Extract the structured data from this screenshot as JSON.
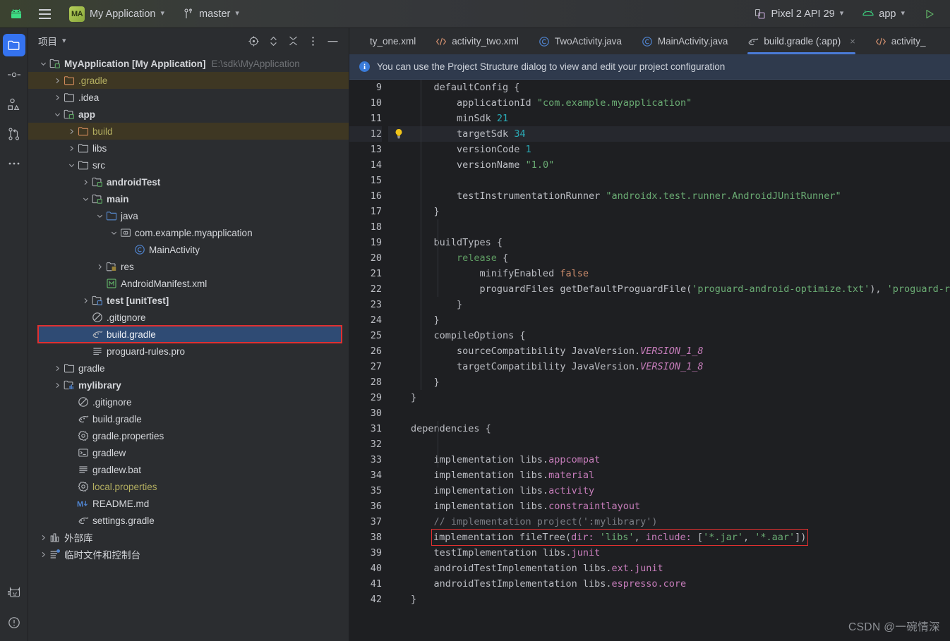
{
  "topbar": {
    "android_icon": "android-robot-icon",
    "menu_icon": "hamburger-menu-icon",
    "project_badge": "MA",
    "project_name": "My Application",
    "branch_icon": "vcs-branch-icon",
    "branch_name": "master",
    "device_icon": "device-icon",
    "device_name": "Pixel 2 API 29",
    "run_config_icon": "android-app-icon",
    "run_config_name": "app",
    "run_icon": "run-play-icon"
  },
  "rail": {
    "items": [
      {
        "name": "project-tool-window",
        "icon": "folder-icon",
        "active": true
      },
      {
        "name": "commit-tool-window",
        "icon": "commit-node-icon",
        "active": false
      },
      {
        "name": "structure-tool-window",
        "icon": "shapes-icon",
        "active": false
      },
      {
        "name": "pull-requests-tool-window",
        "icon": "branch-merge-icon",
        "active": false
      },
      {
        "name": "more-tool-windows",
        "icon": "ellipsis-icon",
        "active": false
      }
    ],
    "bottom_items": [
      {
        "name": "device-manager",
        "icon": "cat-device-icon"
      },
      {
        "name": "problems",
        "icon": "warning-circle-icon"
      }
    ]
  },
  "project_panel": {
    "title": "项目",
    "title_chevron": "chevron-down-icon",
    "actions": [
      {
        "name": "select-opened-file-button",
        "icon": "target-icon"
      },
      {
        "name": "expand-collapse-button",
        "icon": "updown-chevron-icon"
      },
      {
        "name": "collapse-all-button",
        "icon": "collapse-all-icon"
      },
      {
        "name": "options-button",
        "icon": "vertical-dots-icon"
      },
      {
        "name": "hide-button",
        "icon": "minimize-icon"
      }
    ],
    "tree": [
      {
        "depth": 0,
        "arrow": "down",
        "icon": "module-folder-icon",
        "label": "MyApplication [My Application]",
        "bold": true,
        "suffix": "E:\\sdk\\MyApplication"
      },
      {
        "depth": 1,
        "arrow": "right",
        "icon": "excluded-folder-icon",
        "label": ".gradle",
        "yellow": true,
        "highlight": true
      },
      {
        "depth": 1,
        "arrow": "right",
        "icon": "folder-icon",
        "label": ".idea"
      },
      {
        "depth": 1,
        "arrow": "down",
        "icon": "module-folder-icon",
        "label": "app",
        "bold": true
      },
      {
        "depth": 2,
        "arrow": "right",
        "icon": "excluded-folder-icon",
        "label": "build",
        "yellow": true,
        "highlight": true
      },
      {
        "depth": 2,
        "arrow": "right",
        "icon": "folder-icon",
        "label": "libs"
      },
      {
        "depth": 2,
        "arrow": "down",
        "icon": "folder-icon",
        "label": "src"
      },
      {
        "depth": 3,
        "arrow": "right",
        "icon": "module-folder-icon",
        "label": "androidTest",
        "bold": true
      },
      {
        "depth": 3,
        "arrow": "down",
        "icon": "module-folder-icon",
        "label": "main",
        "bold": true
      },
      {
        "depth": 4,
        "arrow": "down",
        "icon": "source-folder-icon",
        "label": "java"
      },
      {
        "depth": 5,
        "arrow": "down",
        "icon": "package-icon",
        "label": "com.example.myapplication"
      },
      {
        "depth": 6,
        "arrow": "none",
        "icon": "java-class-icon",
        "label": "MainActivity"
      },
      {
        "depth": 4,
        "arrow": "right",
        "icon": "res-folder-icon",
        "label": "res"
      },
      {
        "depth": 4,
        "arrow": "none",
        "icon": "manifest-icon",
        "label": "AndroidManifest.xml"
      },
      {
        "depth": 3,
        "arrow": "right",
        "icon": "test-folder-icon",
        "label": "test [unitTest]",
        "bold": true
      },
      {
        "depth": 3,
        "arrow": "none",
        "icon": "gitignore-icon",
        "label": ".gitignore"
      },
      {
        "depth": 3,
        "arrow": "none",
        "icon": "gradle-icon",
        "label": "build.gradle",
        "selected": true
      },
      {
        "depth": 3,
        "arrow": "none",
        "icon": "text-file-icon",
        "label": "proguard-rules.pro"
      },
      {
        "depth": 1,
        "arrow": "right",
        "icon": "folder-icon",
        "label": "gradle"
      },
      {
        "depth": 1,
        "arrow": "right",
        "icon": "library-module-icon",
        "label": "mylibrary",
        "bold": true
      },
      {
        "depth": 2,
        "arrow": "none",
        "icon": "gitignore-icon",
        "label": ".gitignore"
      },
      {
        "depth": 2,
        "arrow": "none",
        "icon": "gradle-icon",
        "label": "build.gradle"
      },
      {
        "depth": 2,
        "arrow": "none",
        "icon": "properties-icon",
        "label": "gradle.properties"
      },
      {
        "depth": 2,
        "arrow": "none",
        "icon": "shell-script-icon",
        "label": "gradlew"
      },
      {
        "depth": 2,
        "arrow": "none",
        "icon": "text-file-icon",
        "label": "gradlew.bat"
      },
      {
        "depth": 2,
        "arrow": "none",
        "icon": "properties-icon",
        "label": "local.properties",
        "yellow": true
      },
      {
        "depth": 2,
        "arrow": "none",
        "icon": "markdown-icon",
        "label": "README.md"
      },
      {
        "depth": 2,
        "arrow": "none",
        "icon": "gradle-icon",
        "label": "settings.gradle"
      },
      {
        "depth": 0,
        "arrow": "right",
        "icon": "external-libraries-icon",
        "label": "外部库"
      },
      {
        "depth": 0,
        "arrow": "right",
        "icon": "scratches-icon",
        "label": "临时文件和控制台"
      }
    ]
  },
  "editor": {
    "tabs": [
      {
        "label": "ty_one.xml",
        "icon": "xml-icon",
        "active": false,
        "closable": false,
        "clipped": true
      },
      {
        "label": "activity_two.xml",
        "icon": "xml-icon",
        "active": false,
        "closable": false
      },
      {
        "label": "TwoActivity.java",
        "icon": "java-class-icon",
        "active": false,
        "closable": false
      },
      {
        "label": "MainActivity.java",
        "icon": "java-class-icon",
        "active": false,
        "closable": false
      },
      {
        "label": "build.gradle (:app)",
        "icon": "gradle-icon",
        "active": true,
        "closable": true
      },
      {
        "label": "activity_",
        "icon": "xml-icon",
        "active": false,
        "closable": false,
        "clipped": true
      }
    ],
    "notification": {
      "icon": "info-icon",
      "text": "You can use the Project Structure dialog to view and edit your project configuration"
    },
    "gutter_hint_icon": "lightbulb-icon",
    "gutter_hint_line": 12,
    "current_line": 12,
    "lines": [
      {
        "n": 9,
        "tokens": [
          {
            "t": "    defaultConfig {",
            "c": "s-def"
          }
        ]
      },
      {
        "n": 10,
        "tokens": [
          {
            "t": "        applicationId ",
            "c": "s-def"
          },
          {
            "t": "\"com.example.myapplication\"",
            "c": "s-str"
          }
        ]
      },
      {
        "n": 11,
        "tokens": [
          {
            "t": "        minSdk ",
            "c": "s-def"
          },
          {
            "t": "21",
            "c": "s-num"
          }
        ]
      },
      {
        "n": 12,
        "tokens": [
          {
            "t": "        targetSdk ",
            "c": "s-def"
          },
          {
            "t": "34",
            "c": "s-num"
          }
        ]
      },
      {
        "n": 13,
        "tokens": [
          {
            "t": "        versionCode ",
            "c": "s-def"
          },
          {
            "t": "1",
            "c": "s-num"
          }
        ]
      },
      {
        "n": 14,
        "tokens": [
          {
            "t": "        versionName ",
            "c": "s-def"
          },
          {
            "t": "\"1.0\"",
            "c": "s-str"
          }
        ]
      },
      {
        "n": 15,
        "tokens": [
          {
            "t": "",
            "c": "s-def"
          }
        ]
      },
      {
        "n": 16,
        "tokens": [
          {
            "t": "        testInstrumentationRunner ",
            "c": "s-def"
          },
          {
            "t": "\"androidx.test.runner.AndroidJUnitRunner\"",
            "c": "s-str"
          }
        ]
      },
      {
        "n": 17,
        "tokens": [
          {
            "t": "    }",
            "c": "s-def"
          }
        ]
      },
      {
        "n": 18,
        "tokens": [
          {
            "t": "",
            "c": "s-def"
          }
        ]
      },
      {
        "n": 19,
        "tokens": [
          {
            "t": "    buildTypes {",
            "c": "s-def"
          }
        ]
      },
      {
        "n": 20,
        "tokens": [
          {
            "t": "        ",
            "c": "s-def"
          },
          {
            "t": "release",
            "c": "s-grn"
          },
          {
            "t": " {",
            "c": "s-def"
          }
        ]
      },
      {
        "n": 21,
        "tokens": [
          {
            "t": "            minifyEnabled ",
            "c": "s-def"
          },
          {
            "t": "false",
            "c": "s-kw"
          }
        ]
      },
      {
        "n": 22,
        "tokens": [
          {
            "t": "            proguardFiles getDefaultProguardFile(",
            "c": "s-def"
          },
          {
            "t": "'proguard-android-optimize.txt'",
            "c": "s-str"
          },
          {
            "t": "), ",
            "c": "s-def"
          },
          {
            "t": "'proguard-rules.pro'",
            "c": "s-str"
          }
        ]
      },
      {
        "n": 23,
        "tokens": [
          {
            "t": "        }",
            "c": "s-def"
          }
        ]
      },
      {
        "n": 24,
        "tokens": [
          {
            "t": "    }",
            "c": "s-def"
          }
        ]
      },
      {
        "n": 25,
        "tokens": [
          {
            "t": "    compileOptions {",
            "c": "s-def"
          }
        ]
      },
      {
        "n": 26,
        "tokens": [
          {
            "t": "        sourceCompatibility JavaVersion.",
            "c": "s-def"
          },
          {
            "t": "VERSION_1_8",
            "c": "s-italic"
          }
        ]
      },
      {
        "n": 27,
        "tokens": [
          {
            "t": "        targetCompatibility JavaVersion.",
            "c": "s-def"
          },
          {
            "t": "VERSION_1_8",
            "c": "s-italic"
          }
        ]
      },
      {
        "n": 28,
        "tokens": [
          {
            "t": "    }",
            "c": "s-def"
          }
        ]
      },
      {
        "n": 29,
        "tokens": [
          {
            "t": "}",
            "c": "s-def"
          }
        ]
      },
      {
        "n": 30,
        "tokens": [
          {
            "t": "",
            "c": "s-def"
          }
        ]
      },
      {
        "n": 31,
        "tokens": [
          {
            "t": "dependencies {",
            "c": "s-def"
          }
        ]
      },
      {
        "n": 32,
        "tokens": [
          {
            "t": "",
            "c": "s-def"
          }
        ]
      },
      {
        "n": 33,
        "tokens": [
          {
            "t": "    implementation libs.",
            "c": "s-def"
          },
          {
            "t": "appcompat",
            "c": "s-prop"
          }
        ]
      },
      {
        "n": 34,
        "tokens": [
          {
            "t": "    implementation libs.",
            "c": "s-def"
          },
          {
            "t": "material",
            "c": "s-prop"
          }
        ]
      },
      {
        "n": 35,
        "tokens": [
          {
            "t": "    implementation libs.",
            "c": "s-def"
          },
          {
            "t": "activity",
            "c": "s-prop"
          }
        ]
      },
      {
        "n": 36,
        "tokens": [
          {
            "t": "    implementation libs.",
            "c": "s-def"
          },
          {
            "t": "constraintlayout",
            "c": "s-prop"
          }
        ]
      },
      {
        "n": 37,
        "tokens": [
          {
            "t": "    // implementation project(':mylibrary')",
            "c": "s-com"
          }
        ]
      },
      {
        "n": 38,
        "tokens": [
          {
            "t": "    implementation fileTree(",
            "c": "s-def"
          },
          {
            "t": "dir: ",
            "c": "s-prop"
          },
          {
            "t": "'libs'",
            "c": "s-str"
          },
          {
            "t": ", ",
            "c": "s-def"
          },
          {
            "t": "include: ",
            "c": "s-prop"
          },
          {
            "t": "[",
            "c": "s-def"
          },
          {
            "t": "'*.jar'",
            "c": "s-str"
          },
          {
            "t": ", ",
            "c": "s-def"
          },
          {
            "t": "'*.aar'",
            "c": "s-str"
          },
          {
            "t": "])",
            "c": "s-def"
          }
        ],
        "boxed": true
      },
      {
        "n": 39,
        "tokens": [
          {
            "t": "    testImplementation libs.",
            "c": "s-def"
          },
          {
            "t": "junit",
            "c": "s-prop"
          }
        ]
      },
      {
        "n": 40,
        "tokens": [
          {
            "t": "    androidTestImplementation libs.",
            "c": "s-def"
          },
          {
            "t": "ext.junit",
            "c": "s-prop"
          }
        ]
      },
      {
        "n": 41,
        "tokens": [
          {
            "t": "    androidTestImplementation libs.",
            "c": "s-def"
          },
          {
            "t": "espresso.core",
            "c": "s-prop"
          }
        ]
      },
      {
        "n": 42,
        "tokens": [
          {
            "t": "}",
            "c": "s-def"
          }
        ]
      }
    ]
  },
  "watermark": "CSDN @一碗情深",
  "colors": {
    "accent_blue": "#3573f0",
    "selection_blue": "#2f4b74",
    "highlight_red": "#e03030",
    "editor_bg": "#1e1f22",
    "panel_bg": "#2b2d30",
    "notification_bg": "#2f3a4d"
  }
}
